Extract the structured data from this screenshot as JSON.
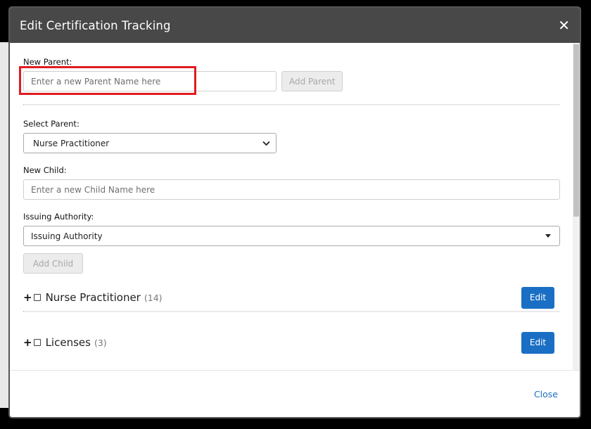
{
  "modal": {
    "title": "Edit Certification Tracking",
    "close_symbol": "✕"
  },
  "new_parent": {
    "label": "New Parent:",
    "placeholder": "Enter a new Parent Name here",
    "value": "",
    "add_button": "Add Parent"
  },
  "select_parent": {
    "label": "Select Parent:",
    "selected": "Nurse Practitioner"
  },
  "new_child": {
    "label": "New Child:",
    "placeholder": "Enter a new Child Name here",
    "value": ""
  },
  "issuing_authority": {
    "label": "Issuing Authority:",
    "selected": "Issuing Authority",
    "add_child_button": "Add Child"
  },
  "tree": {
    "items": [
      {
        "name": "Nurse Practitioner",
        "count": "(14)",
        "edit_label": "Edit"
      },
      {
        "name": "Licenses",
        "count": "(3)",
        "edit_label": "Edit"
      }
    ]
  },
  "footer": {
    "close_label": "Close"
  },
  "colors": {
    "header_bg": "#484848",
    "primary": "#1a6fc4",
    "highlight": "#e11b22"
  },
  "icons": {
    "close": "close-icon",
    "select_chevron": "chevron-down-icon",
    "dropdown_caret": "caret-down-icon",
    "expand": "plus-icon"
  }
}
